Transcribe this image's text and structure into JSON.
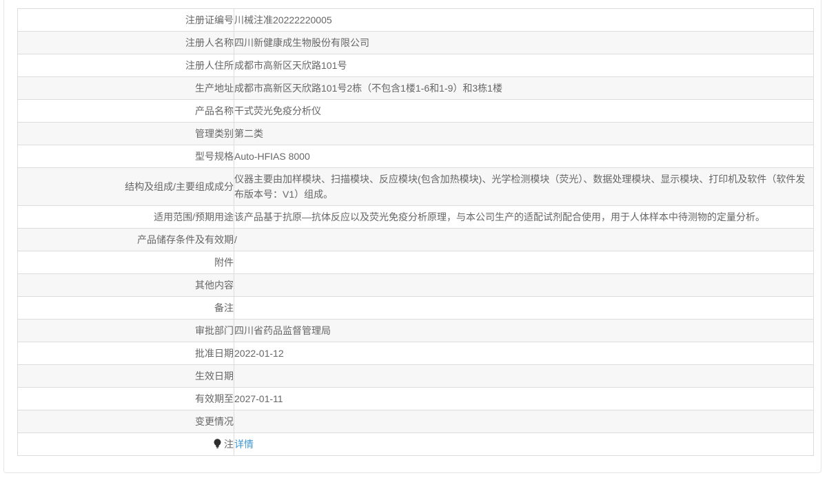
{
  "colors": {
    "link": "#3e97d1",
    "row_alt_bg": "#f7f7f7",
    "border": "#dcdcdc",
    "text": "#666666"
  },
  "table": {
    "rows": [
      {
        "label": "注册证编号",
        "value": "川械注准20222220005"
      },
      {
        "label": "注册人名称",
        "value": "四川新健康成生物股份有限公司"
      },
      {
        "label": "注册人住所",
        "value": "成都市高新区天欣路101号"
      },
      {
        "label": "生产地址",
        "value": "成都市高新区天欣路101号2栋（不包含1楼1-6和1-9）和3栋1楼"
      },
      {
        "label": "产品名称",
        "value": "干式荧光免疫分析仪"
      },
      {
        "label": "管理类别",
        "value": "第二类"
      },
      {
        "label": "型号规格",
        "value": "Auto-HFIAS 8000"
      },
      {
        "label": "结构及组成/主要组成成分",
        "value": "仪器主要由加样模块、扫描模块、反应模块(包含加热模块)、光学检测模块（荧光）、数据处理模块、显示模块、打印机及软件（软件发布版本号：V1）组成。"
      },
      {
        "label": "适用范围/预期用途",
        "value": "该产品基于抗原—抗体反应以及荧光免疫分析原理，与本公司生产的适配试剂配合使用，用于人体样本中待测物的定量分析。"
      },
      {
        "label": "产品储存条件及有效期",
        "value": "/"
      },
      {
        "label": "附件",
        "value": ""
      },
      {
        "label": "其他内容",
        "value": ""
      },
      {
        "label": "备注",
        "value": ""
      },
      {
        "label": "审批部门",
        "value": "四川省药品监督管理局"
      },
      {
        "label": "批准日期",
        "value": "2022-01-12"
      },
      {
        "label": "生效日期",
        "value": ""
      },
      {
        "label": "有效期至",
        "value": "2027-01-11"
      },
      {
        "label": "变更情况",
        "value": ""
      },
      {
        "label": "注",
        "value": "详情",
        "link": true,
        "icon": "bulb-icon"
      }
    ]
  }
}
